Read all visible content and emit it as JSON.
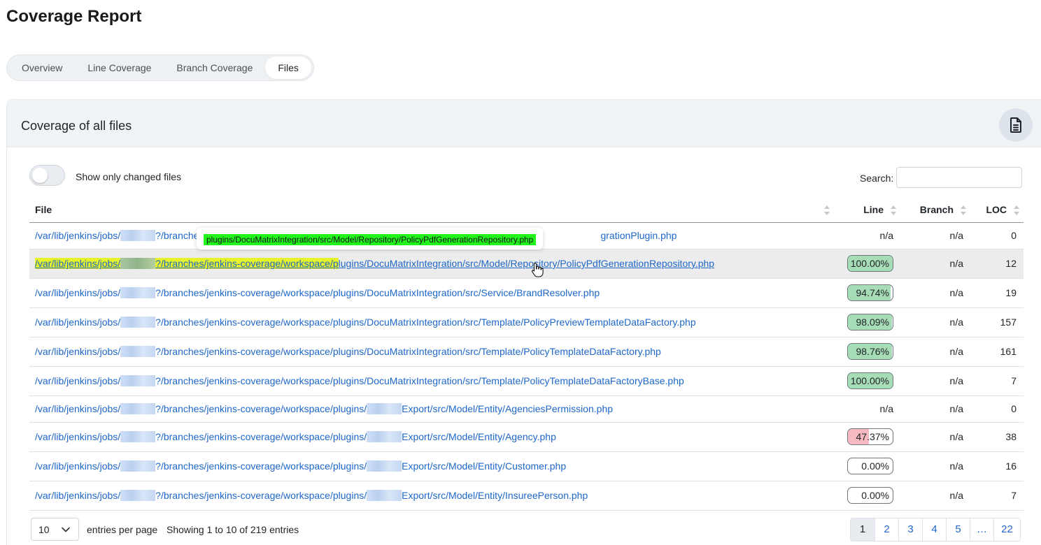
{
  "page": {
    "title": "Coverage Report"
  },
  "tabs": [
    {
      "label": "Overview",
      "active": false
    },
    {
      "label": "Line Coverage",
      "active": false
    },
    {
      "label": "Branch Coverage",
      "active": false
    },
    {
      "label": "Files",
      "active": true
    }
  ],
  "card": {
    "title": "Coverage of all files",
    "action_icon": "document-icon"
  },
  "filters": {
    "toggle_label": "Show only changed files",
    "toggle_on": false,
    "search_label": "Search:",
    "search_value": ""
  },
  "table": {
    "columns": [
      "File",
      "Line",
      "Branch",
      "LOC"
    ],
    "rows": [
      {
        "pre": "/var/lib/jenkins/jobs/",
        "mid": "?/branche",
        "post": "grationPlugin.php",
        "line": "n/a",
        "branch": "n/a",
        "loc": "0"
      },
      {
        "pre": "/var/lib/jenkins/jobs/",
        "mid": "?/branches/jenkins-coverage/workspace/p",
        "post": "lugins/DocuMatrixIntegration/src/Model/Repository/PolicyPdfGenerationRepository.php",
        "line": "100.00%",
        "line_value": 100,
        "branch": "n/a",
        "loc": "12"
      },
      {
        "pre": "/var/lib/jenkins/jobs/",
        "mid": "?/branches/jenkins-coverage/workspace/plugins/DocuMatrixIntegration/src/Service/BrandResolver.php",
        "post": "",
        "line": "94.74%",
        "line_value": 94.74,
        "branch": "n/a",
        "loc": "19"
      },
      {
        "pre": "/var/lib/jenkins/jobs/",
        "mid": "?/branches/jenkins-coverage/workspace/plugins/DocuMatrixIntegration/src/Template/PolicyPreviewTemplateDataFactory.php",
        "post": "",
        "line": "98.09%",
        "line_value": 98.09,
        "branch": "n/a",
        "loc": "157"
      },
      {
        "pre": "/var/lib/jenkins/jobs/",
        "mid": "?/branches/jenkins-coverage/workspace/plugins/DocuMatrixIntegration/src/Template/PolicyTemplateDataFactory.php",
        "post": "",
        "line": "98.76%",
        "line_value": 98.76,
        "branch": "n/a",
        "loc": "161"
      },
      {
        "pre": "/var/lib/jenkins/jobs/",
        "mid": "?/branches/jenkins-coverage/workspace/plugins/DocuMatrixIntegration/src/Template/PolicyTemplateDataFactoryBase.php",
        "post": "",
        "line": "100.00%",
        "line_value": 100,
        "branch": "n/a",
        "loc": "7"
      },
      {
        "pre": "/var/lib/jenkins/jobs/",
        "mid": "?/branches/jenkins-coverage/workspace/plugins/",
        "post": "Export/src/Model/Entity/AgenciesPermission.php",
        "line": "n/a",
        "branch": "n/a",
        "loc": "0"
      },
      {
        "pre": "/var/lib/jenkins/jobs/",
        "mid": "?/branches/jenkins-coverage/workspace/plugins/",
        "post": "Export/src/Model/Entity/Agency.php",
        "line": "47.37%",
        "line_value": 47.37,
        "branch": "n/a",
        "loc": "38"
      },
      {
        "pre": "/var/lib/jenkins/jobs/",
        "mid": "?/branches/jenkins-coverage/workspace/plugins/",
        "post": "Export/src/Model/Entity/Customer.php",
        "line": "0.00%",
        "line_value": 0,
        "branch": "n/a",
        "loc": "16"
      },
      {
        "pre": "/var/lib/jenkins/jobs/",
        "mid": "?/branches/jenkins-coverage/workspace/plugins/",
        "post": "Export/src/Model/Entity/InsureePerson.php",
        "line": "0.00%",
        "line_value": 0,
        "branch": "n/a",
        "loc": "7"
      }
    ]
  },
  "tooltip": {
    "text": "plugins/DocuMatrixIntegration/src/Model/Repository/PolicyPdfGenerationRepository.php"
  },
  "footer": {
    "page_size": "10",
    "entries_label": "entries per page",
    "showing": "Showing 1 to 10 of 219 entries",
    "pages": [
      "1",
      "2",
      "3",
      "4",
      "5",
      "…",
      "22"
    ],
    "current_page": "1"
  },
  "colors": {
    "link": "#1e67c8",
    "good": "#a6dcb6",
    "bad": "#f6b9c0",
    "highlight": "#e6f22a",
    "tooltip_bg": "#22f51c"
  }
}
